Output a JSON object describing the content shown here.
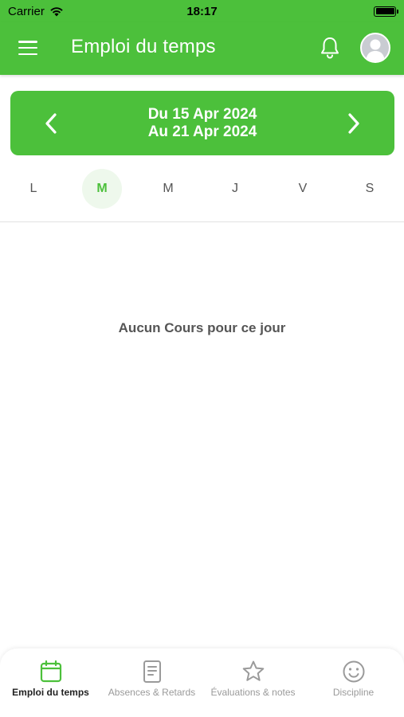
{
  "status_bar": {
    "carrier": "Carrier",
    "time": "18:17"
  },
  "header": {
    "title": "Emploi du temps",
    "icons": [
      "menu-icon",
      "bell-icon",
      "avatar-icon"
    ]
  },
  "week": {
    "from": "Du 15 Apr 2024",
    "to": "Au 21 Apr 2024"
  },
  "days": [
    {
      "label": "L",
      "active": false
    },
    {
      "label": "M",
      "active": true
    },
    {
      "label": "M",
      "active": false
    },
    {
      "label": "J",
      "active": false
    },
    {
      "label": "V",
      "active": false
    },
    {
      "label": "S",
      "active": false
    }
  ],
  "empty_message": "Aucun Cours pour ce jour",
  "tabs": [
    {
      "label": "Emploi du temps",
      "icon": "calendar-icon",
      "active": true
    },
    {
      "label": "Absences & Retards",
      "icon": "document-icon",
      "active": false
    },
    {
      "label": "Évaluations & notes",
      "icon": "star-icon",
      "active": false
    },
    {
      "label": "Discipline",
      "icon": "smiley-icon",
      "active": false
    }
  ],
  "colors": {
    "primary": "#4cc03b",
    "active_day_bg": "#eef8ec",
    "inactive_tab": "#9a9a9a"
  }
}
